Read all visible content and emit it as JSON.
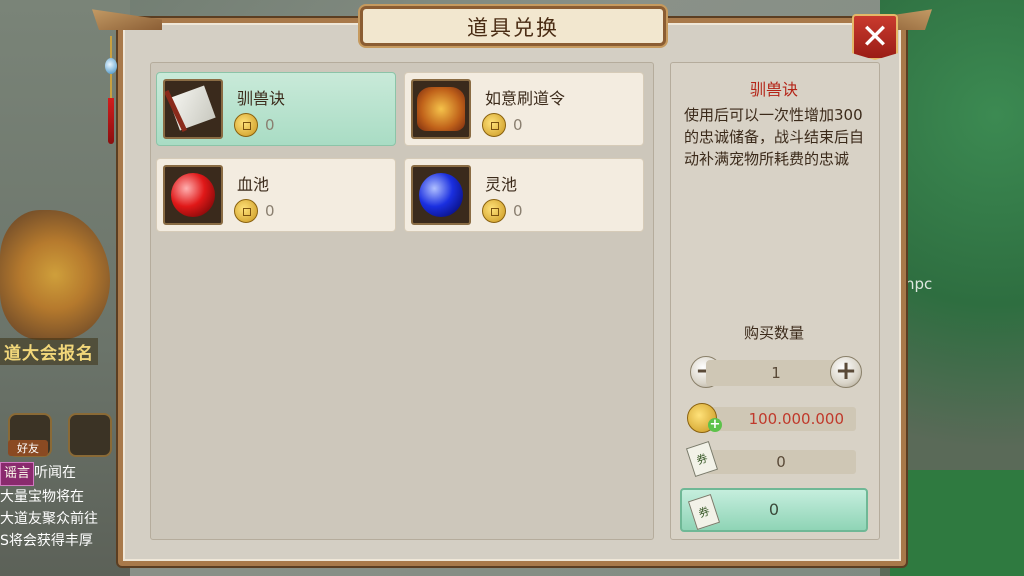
{
  "background": {
    "npc_label": "npc",
    "event_text": "道大会报名",
    "friend_button": "好友",
    "chat_lines": [
      {
        "tag": "谣言",
        "text": "听闻在"
      },
      {
        "tag": "",
        "text": "大量宝物将在"
      },
      {
        "tag": "",
        "text": "大道友聚众前往"
      },
      {
        "tag": "",
        "text": "S将会获得丰厚"
      }
    ]
  },
  "dialog": {
    "title": "道具兑换",
    "close_icon": "close-icon"
  },
  "items": [
    {
      "name": "驯兽诀",
      "price": "0",
      "icon": "scroll-icon",
      "selected": true
    },
    {
      "name": "如意刷道令",
      "price": "0",
      "icon": "seal-icon",
      "selected": false
    },
    {
      "name": "血池",
      "price": "0",
      "icon": "red-orb-icon",
      "selected": false
    },
    {
      "name": "灵池",
      "price": "0",
      "icon": "blue-orb-icon",
      "selected": false
    }
  ],
  "detail": {
    "title": "驯兽诀",
    "description": "使用后可以一次性增加300的忠诚储备，战斗结束后自动补满宠物所耗费的忠诚",
    "quantity_label": "购买数量",
    "quantity": "1",
    "minus_label": "−",
    "plus_label": "+",
    "cost": "100.000.000",
    "ticket_count": "0",
    "exchange_value": "0",
    "ticket_glyph": "券"
  },
  "colors": {
    "accent_red": "#b42417",
    "selected_green": "#a9dcc4",
    "frame_brown": "#a8794a"
  }
}
